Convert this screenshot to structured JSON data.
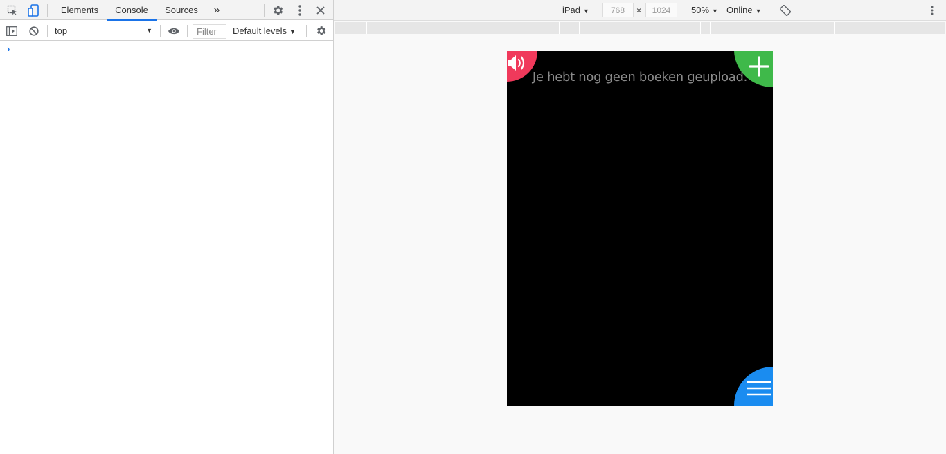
{
  "devtools": {
    "tabs": [
      "Elements",
      "Console",
      "Sources"
    ],
    "active_tab": "Console",
    "more_tabs_glyph": "»",
    "console": {
      "context": "top",
      "filter_placeholder": "Filter",
      "levels": "Default levels",
      "prompt": "›"
    }
  },
  "device_toolbar": {
    "device": "iPad",
    "width": "768",
    "height": "1024",
    "times": "×",
    "zoom": "50%",
    "throttling": "Online"
  },
  "app": {
    "empty_message": "Je hebt nog geen boeken geupload.",
    "colors": {
      "sound_button": "#f0395b",
      "add_button": "#3fb94a",
      "menu_button": "#1a8cf0"
    },
    "icons": [
      "speaker-icon",
      "plus-icon",
      "hamburger-menu-icon"
    ]
  }
}
